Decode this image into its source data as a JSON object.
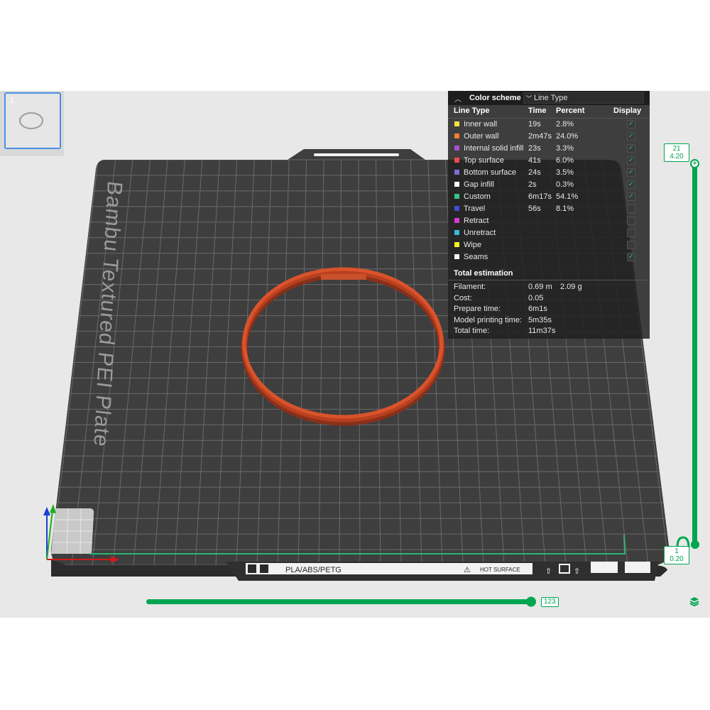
{
  "plate_thumbnail": {
    "index": "1"
  },
  "plate": {
    "name": "Bambu Textured PEI Plate",
    "materials": "PLA/ABS/PETG",
    "warning": "HOT SURFACE"
  },
  "legend": {
    "header": "Color scheme",
    "scheme_value": "Line Type",
    "columns": {
      "line_type": "Line Type",
      "time": "Time",
      "percent": "Percent",
      "display": "Display"
    },
    "items": [
      {
        "label": "Inner wall",
        "time": "19s",
        "percent": "2.8%",
        "color": "#f5e43d",
        "display": true
      },
      {
        "label": "Outer wall",
        "time": "2m47s",
        "percent": "24.0%",
        "color": "#ff7d38",
        "display": true
      },
      {
        "label": "Internal solid infill",
        "time": "23s",
        "percent": "3.3%",
        "color": "#a54fd4",
        "display": true
      },
      {
        "label": "Top surface",
        "time": "41s",
        "percent": "6.0%",
        "color": "#ef4b4b",
        "display": true
      },
      {
        "label": "Bottom surface",
        "time": "24s",
        "percent": "3.5%",
        "color": "#7a6fd6",
        "display": true
      },
      {
        "label": "Gap infill",
        "time": "2s",
        "percent": "0.3%",
        "color": "#ffffff",
        "display": true
      },
      {
        "label": "Custom",
        "time": "6m17s",
        "percent": "54.1%",
        "color": "#35c48a",
        "display": true
      },
      {
        "label": "Travel",
        "time": "56s",
        "percent": "8.1%",
        "color": "#3d4fd1",
        "display": false
      },
      {
        "label": "Retract",
        "time": "",
        "percent": "",
        "color": "#d63bd6",
        "display": false
      },
      {
        "label": "Unretract",
        "time": "",
        "percent": "",
        "color": "#3fb8d4",
        "display": false
      },
      {
        "label": "Wipe",
        "time": "",
        "percent": "",
        "color": "#f5f51f",
        "display": false
      },
      {
        "label": "Seams",
        "time": "",
        "percent": "",
        "color": "#f0f0f0",
        "display": true
      }
    ],
    "total_title": "Total estimation",
    "totals": [
      {
        "label": "Filament:",
        "value": "0.69 m",
        "extra": "2.09 g"
      },
      {
        "label": "Cost:",
        "value": "0.05",
        "extra": ""
      },
      {
        "label": "Prepare time:",
        "value": "6m1s",
        "extra": ""
      },
      {
        "label": "Model printing time:",
        "value": "5m35s",
        "extra": ""
      },
      {
        "label": "Total time:",
        "value": "11m37s",
        "extra": ""
      }
    ]
  },
  "layer_slider": {
    "top_layer": "21",
    "top_height": "4.20",
    "bottom_layer": "1",
    "bottom_height": "0.20"
  },
  "move_slider": {
    "value": "123"
  },
  "colors": {
    "accent": "#00a650",
    "plate": "#3a3a3a",
    "print": "#d9532b"
  }
}
